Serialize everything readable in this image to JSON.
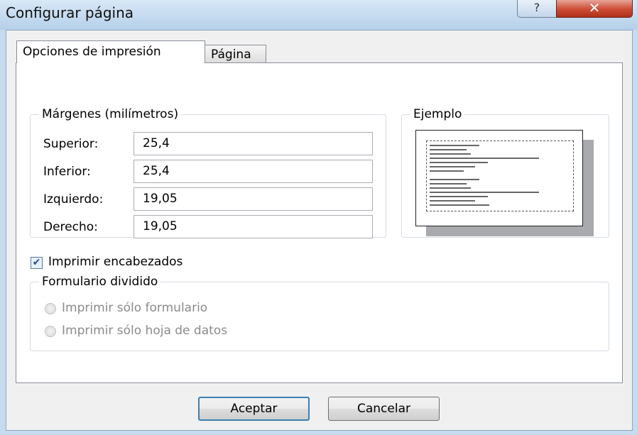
{
  "window": {
    "title": "Configurar página",
    "help_label": "?",
    "close_label": "✕"
  },
  "tabs": [
    {
      "label": "Opciones de impresión",
      "active": true
    },
    {
      "label": "Página",
      "active": false
    }
  ],
  "margins": {
    "legend": "Márgenes (milímetros)",
    "fields": [
      {
        "label": "Superior:",
        "value": "25,4"
      },
      {
        "label": "Inferior:",
        "value": "25,4"
      },
      {
        "label": "Izquierdo:",
        "value": "19,05"
      },
      {
        "label": "Derecho:",
        "value": "19,05"
      }
    ]
  },
  "example": {
    "legend": "Ejemplo"
  },
  "print_headings": {
    "label": "Imprimir encabezados",
    "checked": true
  },
  "split_form": {
    "legend": "Formulario dividido",
    "options": [
      {
        "label": "Imprimir sólo formulario",
        "enabled": false
      },
      {
        "label": "Imprimir sólo hoja de datos",
        "enabled": false
      }
    ]
  },
  "buttons": {
    "ok": "Aceptar",
    "cancel": "Cancelar"
  },
  "colors": {
    "close": "#cc4b32",
    "default_button_border": "#3c7fb1"
  }
}
